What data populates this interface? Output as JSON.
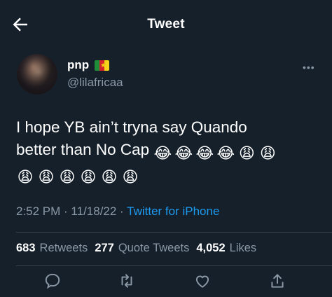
{
  "header": {
    "title": "Tweet"
  },
  "author": {
    "name": "pnp",
    "handle": "@lilafricaa"
  },
  "tweet": {
    "line1": "I hope YB ain’t tryna say Quando",
    "line2": "better than No Cap",
    "emojis_line2": [
      "😂",
      "😂",
      "😂",
      "😂",
      "😩",
      "😩"
    ],
    "emojis_line3": [
      "😩",
      "😩",
      "😩",
      "😩",
      "😩",
      "😩"
    ]
  },
  "meta": {
    "time": "2:52 PM · 11/18/22 · ",
    "source": "Twitter for iPhone"
  },
  "stats": {
    "retweets_count": "683",
    "retweets_label": "Retweets",
    "quotes_count": "277",
    "quotes_label": "Quote Tweets",
    "likes_count": "4,052",
    "likes_label": "Likes"
  },
  "more_label": "•••",
  "colors": {
    "background": "#15202b",
    "secondary_text": "#8b98a5",
    "link": "#1d9bf0",
    "divider": "#38444d"
  }
}
